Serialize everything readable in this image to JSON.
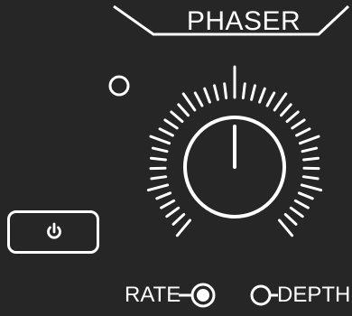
{
  "effect": {
    "title": "PHASER"
  },
  "modes": {
    "rate_label": "RATE",
    "depth_label": "DEPTH",
    "selected": "RATE"
  },
  "power": {
    "icon": "power-icon"
  },
  "led": {
    "state": "off"
  },
  "knob": {
    "icon": "rotary-knob",
    "value": 0.5
  },
  "colors": {
    "background": "#262626",
    "foreground": "#ffffff"
  }
}
